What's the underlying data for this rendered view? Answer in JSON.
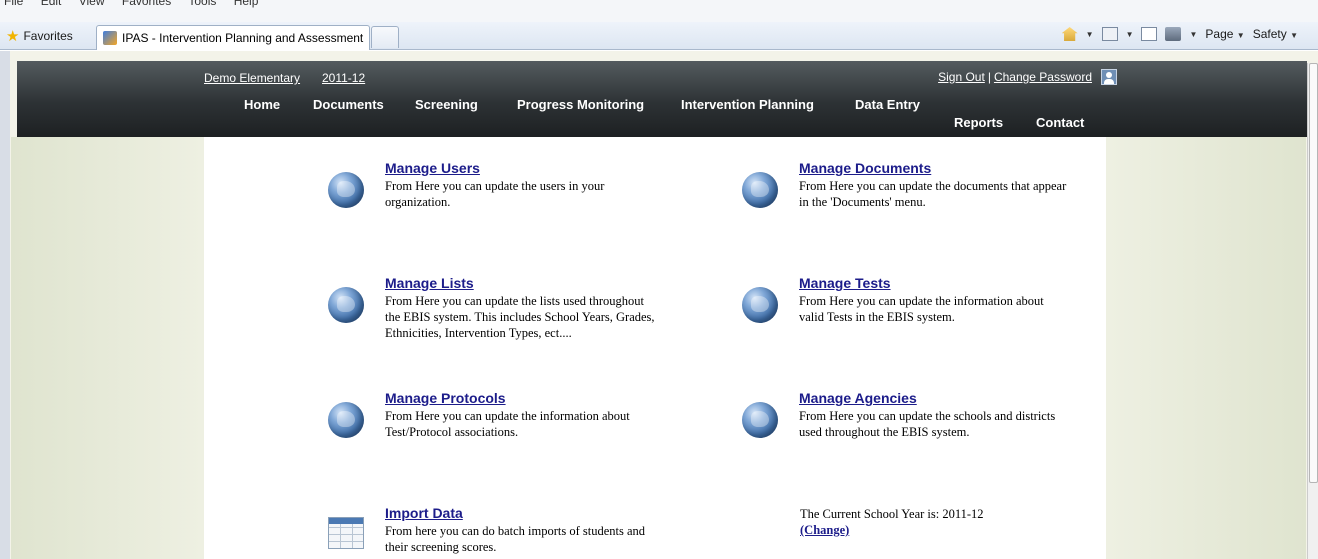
{
  "browser": {
    "menu": [
      "File",
      "Edit",
      "View",
      "Favorites",
      "Tools",
      "Help"
    ],
    "favorites_label": "Favorites",
    "tab_title": "IPAS - Intervention Planning and Assessment",
    "page_label": "Page",
    "safety_label": "Safety"
  },
  "header": {
    "school": "Demo Elementary",
    "year": "2011-12",
    "sign_out": "Sign Out",
    "separator": "|",
    "change_password": "Change Password"
  },
  "nav": {
    "home": "Home",
    "documents": "Documents",
    "screening": "Screening",
    "progress_monitoring": "Progress Monitoring",
    "intervention_planning": "Intervention Planning",
    "data_entry": "Data Entry",
    "reports": "Reports",
    "contact": "Contact"
  },
  "admin": {
    "manage_users": {
      "title": "Manage Users",
      "desc": "From Here you can update the users in your organization."
    },
    "manage_documents": {
      "title": "Manage Documents",
      "desc": "From Here you can update the documents that appear in the 'Documents' menu."
    },
    "manage_lists": {
      "title": "Manage Lists",
      "desc": "From Here you can update the lists used throughout the EBIS system. This includes School Years, Grades, Ethnicities, Intervention Types, ect...."
    },
    "manage_tests": {
      "title": "Manage Tests",
      "desc": "From Here you can update the information about valid Tests in the EBIS system."
    },
    "manage_protocols": {
      "title": "Manage Protocols",
      "desc": "From Here you can update the information about Test/Protocol associations."
    },
    "manage_agencies": {
      "title": "Manage Agencies",
      "desc": "From Here you can update the schools and districts used throughout the EBIS system."
    },
    "import_data": {
      "title": "Import Data",
      "desc": "From here you can do batch imports of students and their screening scores."
    }
  },
  "school_year": {
    "label": "The Current School Year is: 2011-12",
    "change": "(Change)"
  }
}
